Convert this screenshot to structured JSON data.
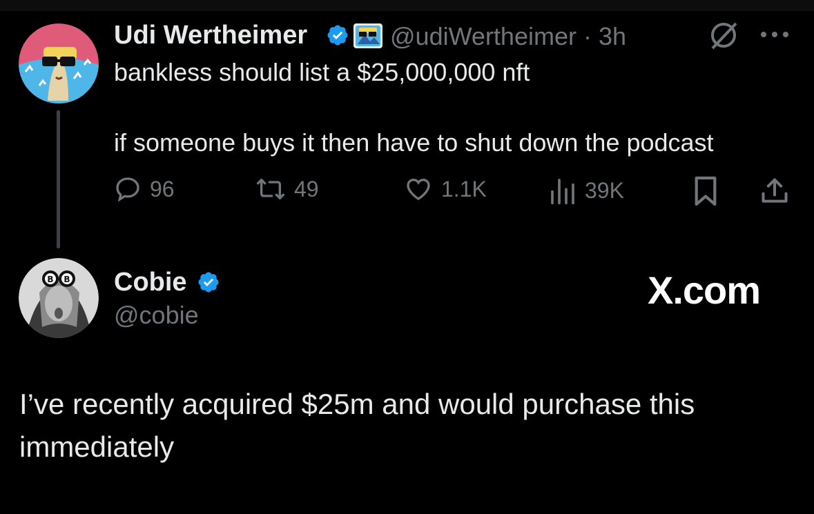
{
  "tweet": {
    "author_name": "Udi Wertheimer",
    "handle": "@udiWertheimer",
    "separator": "·",
    "time": "3h",
    "line1": "bankless should list a $25,000,000 nft",
    "line2": "if someone buys it then have to shut down the podcast",
    "stats": {
      "replies": "96",
      "reposts": "49",
      "likes": "1.1K",
      "views": "39K"
    }
  },
  "reply": {
    "author_name": "Cobie",
    "handle": "@cobie",
    "text_line1": "I’ve recently acquired $25m and would purchase this",
    "text_line2": "immediately"
  },
  "watermark": "X.com",
  "colors": {
    "background": "#000000",
    "text": "#e7e9ea",
    "muted": "#71767b",
    "verified": "#1d9bf0"
  },
  "icons": [
    "verified-badge-icon",
    "grok-icon",
    "more-icon",
    "reply-icon",
    "repost-icon",
    "like-icon",
    "views-icon",
    "bookmark-icon",
    "share-icon"
  ]
}
